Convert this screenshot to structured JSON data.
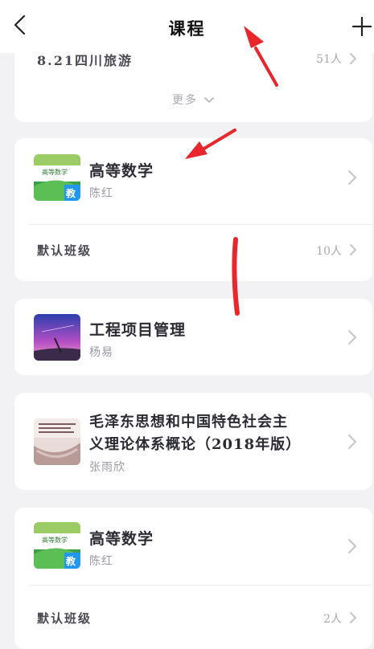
{
  "nav": {
    "title": "课程",
    "back_icon": "chevron-left-icon",
    "add_icon": "plus-icon"
  },
  "top_card": {
    "class_name": "8.21四川旅游",
    "class_count": "51人",
    "more_label": "更多"
  },
  "courses": [
    {
      "title": "高等数学",
      "teacher": "陈红",
      "cover_badge": "教",
      "cover_text": "高等数学",
      "class_name": "默认班级",
      "class_count": "10人"
    },
    {
      "title": "工程项目管理",
      "teacher": "杨易"
    },
    {
      "title_line1": "毛泽东思想和中国特色社会主",
      "title_line2": "义理论体系概论（2018年版）",
      "teacher": "张雨欣"
    },
    {
      "title": "高等数学",
      "teacher": "陈红",
      "cover_badge": "教",
      "cover_text": "高等数学",
      "class_name": "默认班级",
      "class_count": "2人"
    }
  ],
  "colors": {
    "background": "#f2f2f4",
    "card": "#ffffff",
    "annotation_red": "#e8262b"
  }
}
